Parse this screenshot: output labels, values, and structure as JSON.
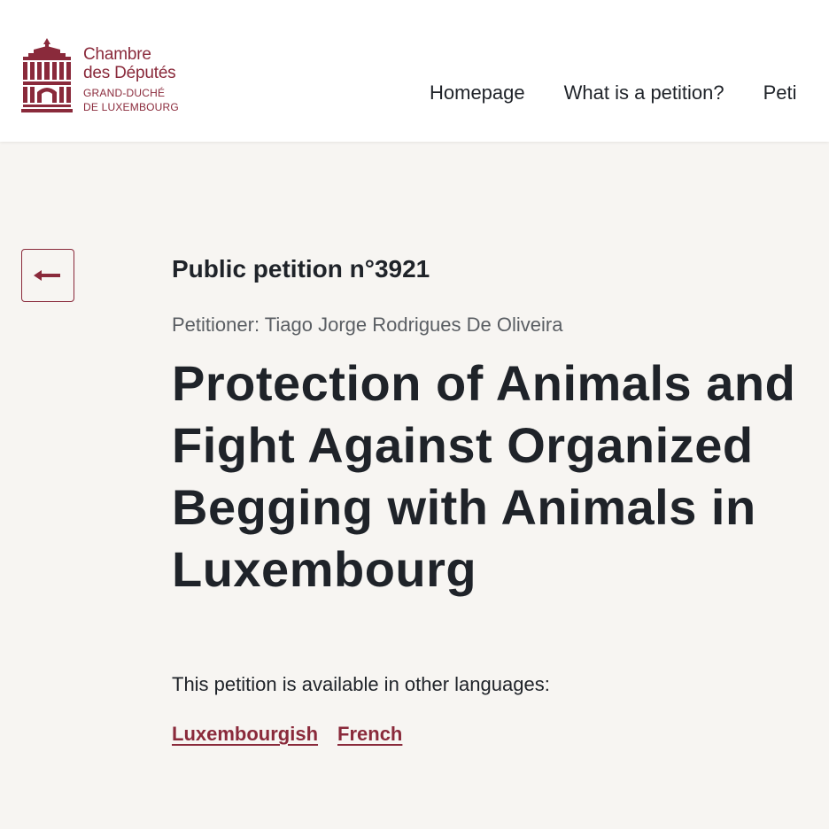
{
  "header": {
    "logo": {
      "line1": "Chambre",
      "line2": "des Députés",
      "line3": "GRAND-DUCHÉ",
      "line4": "DE LUXEMBOURG"
    },
    "nav": {
      "items": [
        {
          "label": "Homepage"
        },
        {
          "label": "What is a petition?"
        },
        {
          "label": "Peti"
        }
      ]
    }
  },
  "main": {
    "back_icon": "arrow-left-icon",
    "petition_number": "Public petition n°3921",
    "petitioner": "Petitioner: Tiago Jorge Rodrigues De Oliveira",
    "title": "Protection of Animals and Fight Against Organized Begging with Animals in Luxembourg",
    "languages_label": "This petition is available in other languages:",
    "languages": [
      {
        "label": "Luxembourgish"
      },
      {
        "label": "French"
      }
    ]
  },
  "colors": {
    "brand": "#8a2a3b",
    "background": "#f7f5f2",
    "header_bg": "#ffffff",
    "text": "#1f2329",
    "muted": "#5a5e63"
  }
}
